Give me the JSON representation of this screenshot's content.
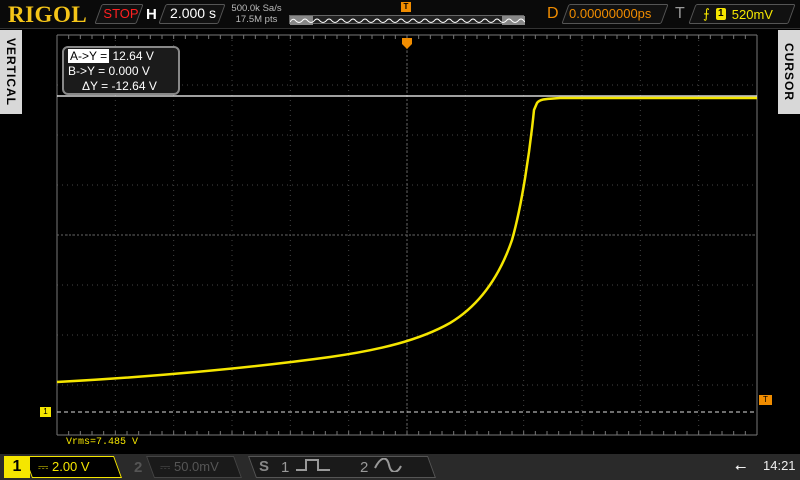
{
  "header": {
    "brand": "RIGOL",
    "run_state": "STOP",
    "h_label": "H",
    "timebase": "2.000 s",
    "sample_rate": "500.0k Sa/s",
    "memory_depth": "17.5M pts",
    "delay_label": "D",
    "delay": "0.00000000ps",
    "trigger_label": "T",
    "trigger_source": "1",
    "trigger_level": "520mV",
    "trigger_marker": "T"
  },
  "side": {
    "left": "VERTICAL",
    "right": "CURSOR"
  },
  "cursor": {
    "a_label": "A->Y =",
    "a_value": "12.64 V",
    "b_label": "B->Y =",
    "b_value": "0.000 V",
    "d_label": "ΔY =",
    "d_value": "-12.64 V"
  },
  "measurement": {
    "vrms": "Vrms=7.485  V"
  },
  "channels": {
    "ch1": {
      "num": "1",
      "scale": "⎓ 2.00 V"
    },
    "ch2": {
      "num": "2",
      "scale": "⎓ 50.0mV"
    },
    "s": {
      "label": "S",
      "s1": "1",
      "s2": "2"
    }
  },
  "markers": {
    "ground": "1",
    "trig_level": "T"
  },
  "status": {
    "time": "14:21"
  },
  "colors": {
    "ch1": "#f5e600",
    "accent": "#f08c00"
  }
}
